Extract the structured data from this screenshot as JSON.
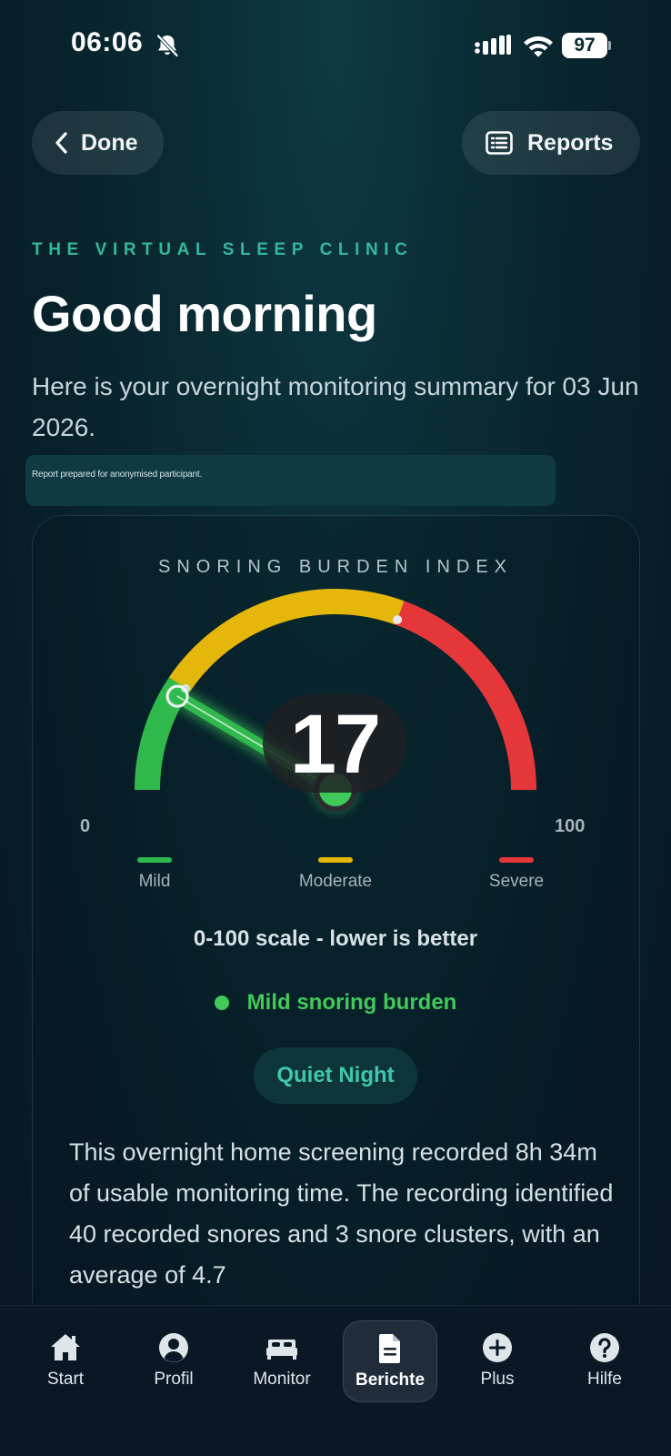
{
  "status_bar": {
    "time": "06:06",
    "battery": "97"
  },
  "header": {
    "done_label": "Done",
    "reports_label": "Reports"
  },
  "eyebrow": "THE VIRTUAL SLEEP CLINIC",
  "greeting": "Good morning",
  "summary": "Here is your overnight monitoring summary for 03 Jun 2026.",
  "prepared_note": "Report prepared for anonymised participant.",
  "gauge": {
    "title": "SNORING BURDEN INDEX",
    "score": "17",
    "value": 17,
    "min": "0",
    "max": "100",
    "colors": {
      "mild": "#2fb94d",
      "moderate": "#e4b70a",
      "severe": "#e5373a"
    },
    "legend": [
      {
        "label": "Mild",
        "color": "#2fb94d"
      },
      {
        "label": "Moderate",
        "color": "#e4b70a"
      },
      {
        "label": "Severe",
        "color": "#e5373a"
      }
    ]
  },
  "scale_note": "0-100 scale - lower is better",
  "status_text": "Mild snoring burden",
  "night_label": "Quiet Night",
  "body_text": "This overnight home screening recorded 8h 34m of usable monitoring time. The recording identified 40 recorded snores and 3 snore clusters, with an average of 4.7",
  "nav": [
    {
      "label": "Start",
      "icon": "home-icon"
    },
    {
      "label": "Profil",
      "icon": "user-icon"
    },
    {
      "label": "Monitor",
      "icon": "bed-icon"
    },
    {
      "label": "Berichte",
      "icon": "document-icon"
    },
    {
      "label": "Plus",
      "icon": "plus-circle-icon"
    },
    {
      "label": "Hilfe",
      "icon": "help-icon"
    }
  ]
}
